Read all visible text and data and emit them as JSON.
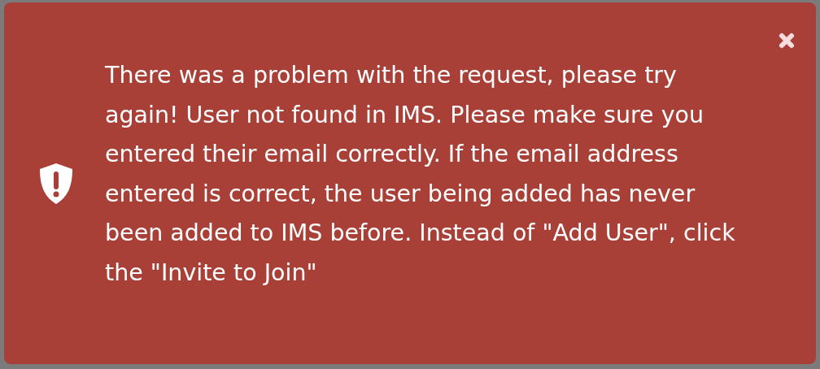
{
  "alert": {
    "kind": "error",
    "message": "There was a problem with the request, please try again! User not found in IMS. Please make sure you entered their email correctly. If the email address entered is correct, the user being added has never been added to IMS before. Instead of \"Add User\", click the \"Invite to Join\""
  }
}
